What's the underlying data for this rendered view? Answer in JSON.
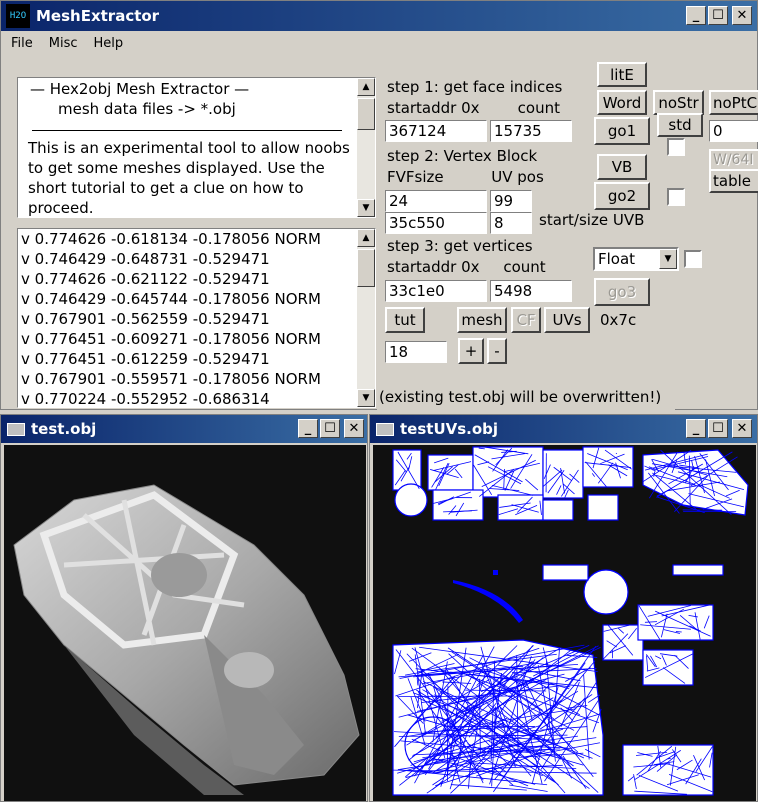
{
  "app": {
    "icon_text": "H2O",
    "title": "MeshExtractor",
    "menu": [
      "File",
      "Misc",
      "Help"
    ]
  },
  "info": {
    "header1": "—   Hex2obj Mesh Extractor   —",
    "header2": "mesh data files -> *.obj",
    "body": "This is an experimental tool to allow noobs to get some meshes displayed. Use the short tutorial to get a clue on how to proceed."
  },
  "vertices": [
    "v 0.774626 -0.618134 -0.178056  NORM",
    "v 0.746429 -0.648731 -0.529471",
    "v 0.774626 -0.621122 -0.529471",
    "v 0.746429 -0.645744 -0.178056  NORM",
    "v 0.767901 -0.562559 -0.529471",
    "v 0.776451 -0.609271 -0.178056  NORM",
    "v 0.776451 -0.612259 -0.529471",
    "v 0.767901 -0.559571 -0.178056  NORM",
    "v 0.770224 -0.552952 -0.686314"
  ],
  "step1": {
    "title": "step 1: get face indices",
    "sub": "startaddr 0x        count",
    "addr": "367124",
    "count": "15735"
  },
  "step2": {
    "title": "step 2: Vertex Block",
    "sub": "FVFsize          UV pos",
    "fvf": "24",
    "uvpos": "99",
    "addr": "35c550",
    "size": "8",
    "uvb_label": "start/size UVB"
  },
  "step3": {
    "title": "step 3: get vertices",
    "sub": "startaddr 0x     count",
    "addr": "33c1e0",
    "count": "5498",
    "format": "Float"
  },
  "buttons": {
    "lite": "litE",
    "word": "Word",
    "nostr": "noStr",
    "noptc": "noPtC",
    "go1": "go1",
    "std": "std",
    "zero_field": "0",
    "vb": "VB",
    "w64": "W/64I",
    "table": "table",
    "go2": "go2",
    "go3": "go3",
    "tut": "tut",
    "mesh": "mesh",
    "cf": "CF",
    "uvs": "UVs",
    "hex": "0x7c",
    "num": "18",
    "plus": "+",
    "minus": "-"
  },
  "warning": "(existing test.obj will be overwritten!)",
  "window2": {
    "title": "test.obj"
  },
  "window3": {
    "title": "testUVs.obj"
  },
  "colors": {
    "uv_line": "#0000ff",
    "viewport_bg": "#101010"
  }
}
